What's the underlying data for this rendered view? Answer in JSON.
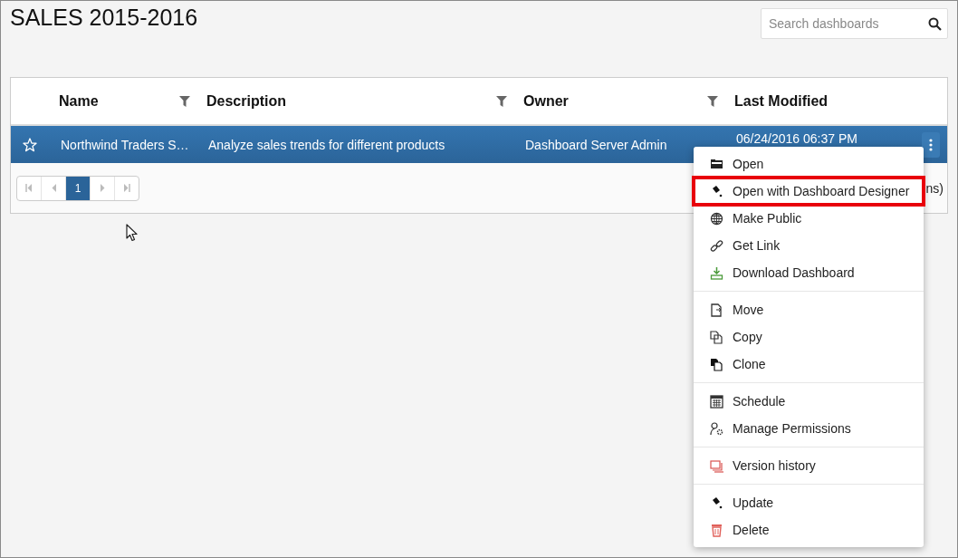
{
  "page": {
    "title": "SALES 2015-2016"
  },
  "search": {
    "placeholder": "Search dashboards"
  },
  "table": {
    "columns": [
      {
        "label": "Name",
        "filter": true
      },
      {
        "label": "Description",
        "filter": true
      },
      {
        "label": "Owner",
        "filter": true
      },
      {
        "label": "Last Modified",
        "filter": false
      }
    ],
    "rows": [
      {
        "selected": true,
        "starred": false,
        "cells": [
          "Northwind Traders S…",
          "Analyze sales trends for different products",
          "Dashboard Server Admin",
          "06/24/2016 06:37 PM"
        ]
      }
    ]
  },
  "pager": {
    "pages": [
      {
        "label": "1",
        "selected": true
      }
    ],
    "info": "ns)"
  },
  "context_menu": {
    "groups": [
      [
        {
          "label": "Open",
          "highlighted": false
        },
        {
          "label": "Open with Dashboard Designer",
          "highlighted": true
        },
        {
          "label": "Make Public",
          "highlighted": false
        },
        {
          "label": "Get Link",
          "highlighted": false
        },
        {
          "label": "Download Dashboard",
          "highlighted": false
        }
      ],
      [
        {
          "label": "Move",
          "highlighted": false
        },
        {
          "label": "Copy",
          "highlighted": false
        },
        {
          "label": "Clone",
          "highlighted": false
        }
      ],
      [
        {
          "label": "Schedule",
          "highlighted": false
        },
        {
          "label": "Manage Permissions",
          "highlighted": false
        }
      ],
      [
        {
          "label": "Version history",
          "highlighted": false
        }
      ],
      [
        {
          "label": "Update",
          "highlighted": false
        },
        {
          "label": "Delete",
          "highlighted": false
        }
      ]
    ]
  }
}
